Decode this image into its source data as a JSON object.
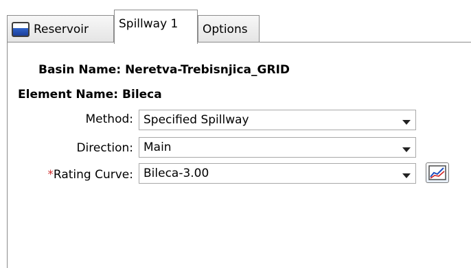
{
  "tabs": {
    "reservoir": "Reservoir",
    "spillway": "Spillway 1",
    "options": "Options"
  },
  "basin": {
    "label": "Basin Name:",
    "value": "Neretva-Trebisnjica_GRID"
  },
  "element": {
    "label": "Element Name:",
    "value": "Bileca"
  },
  "method": {
    "label": "Method:",
    "value": "Specified Spillway"
  },
  "direction": {
    "label": "Direction:",
    "value": "Main"
  },
  "rating_curve": {
    "required_mark": "*",
    "label": "Rating Curve:",
    "value": "Bileca-3.00"
  },
  "icons": {
    "reservoir_tab": "reservoir-icon",
    "graph_button": "graph-icon",
    "dropdown": "chevron-down-icon"
  },
  "colors": {
    "required": "#d03030",
    "tab_border": "#8c8c8c",
    "graph_line_blue": "#1f4fbf",
    "graph_line_red": "#d02020"
  }
}
